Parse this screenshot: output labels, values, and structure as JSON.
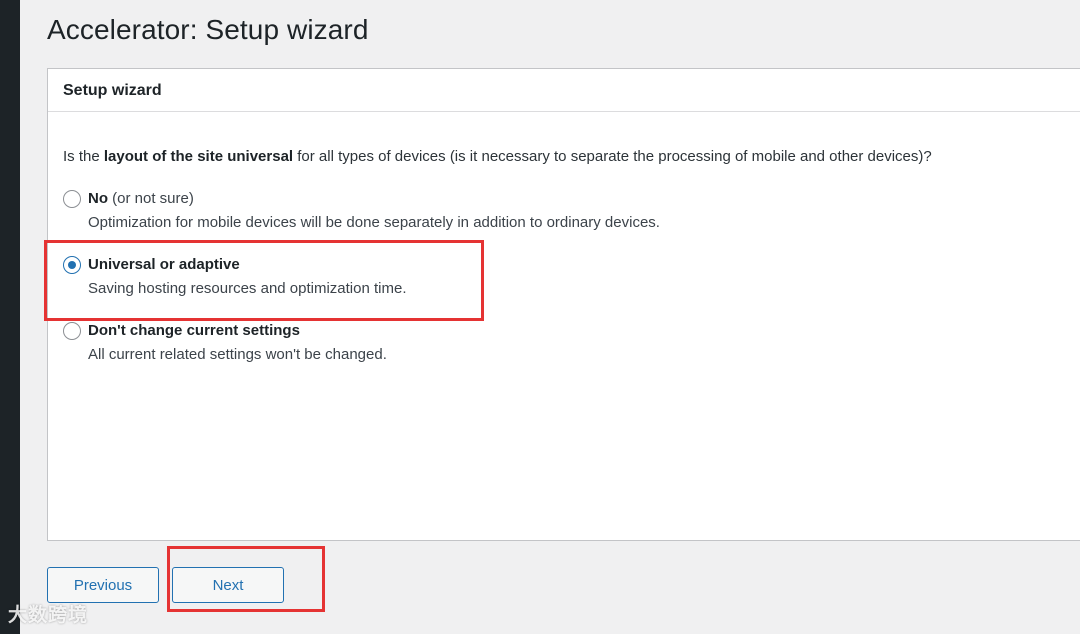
{
  "page": {
    "title": "Accelerator: Setup wizard"
  },
  "panel": {
    "header": "Setup wizard",
    "question": {
      "before": "Is the ",
      "bold": "layout of the site universal",
      "after": " for all types of devices (is it necessary to separate the processing of mobile and other devices)?"
    },
    "options": [
      {
        "title": "No",
        "title_suffix": " (or not sure)",
        "description": "Optimization for mobile devices will be done separately in addition to ordinary devices.",
        "checked": false
      },
      {
        "title": "Universal or adaptive",
        "title_suffix": "",
        "description": "Saving hosting resources and optimization time.",
        "checked": true
      },
      {
        "title": "Don't change current settings",
        "title_suffix": "",
        "description": "All current related settings won't be changed.",
        "checked": false
      }
    ]
  },
  "buttons": {
    "previous": "Previous",
    "next": "Next"
  },
  "watermark": "大数跨境",
  "colors": {
    "accent": "#2271b1",
    "highlight": "#e53333",
    "background": "#f0f0f1",
    "sidebar": "#1d2327"
  }
}
